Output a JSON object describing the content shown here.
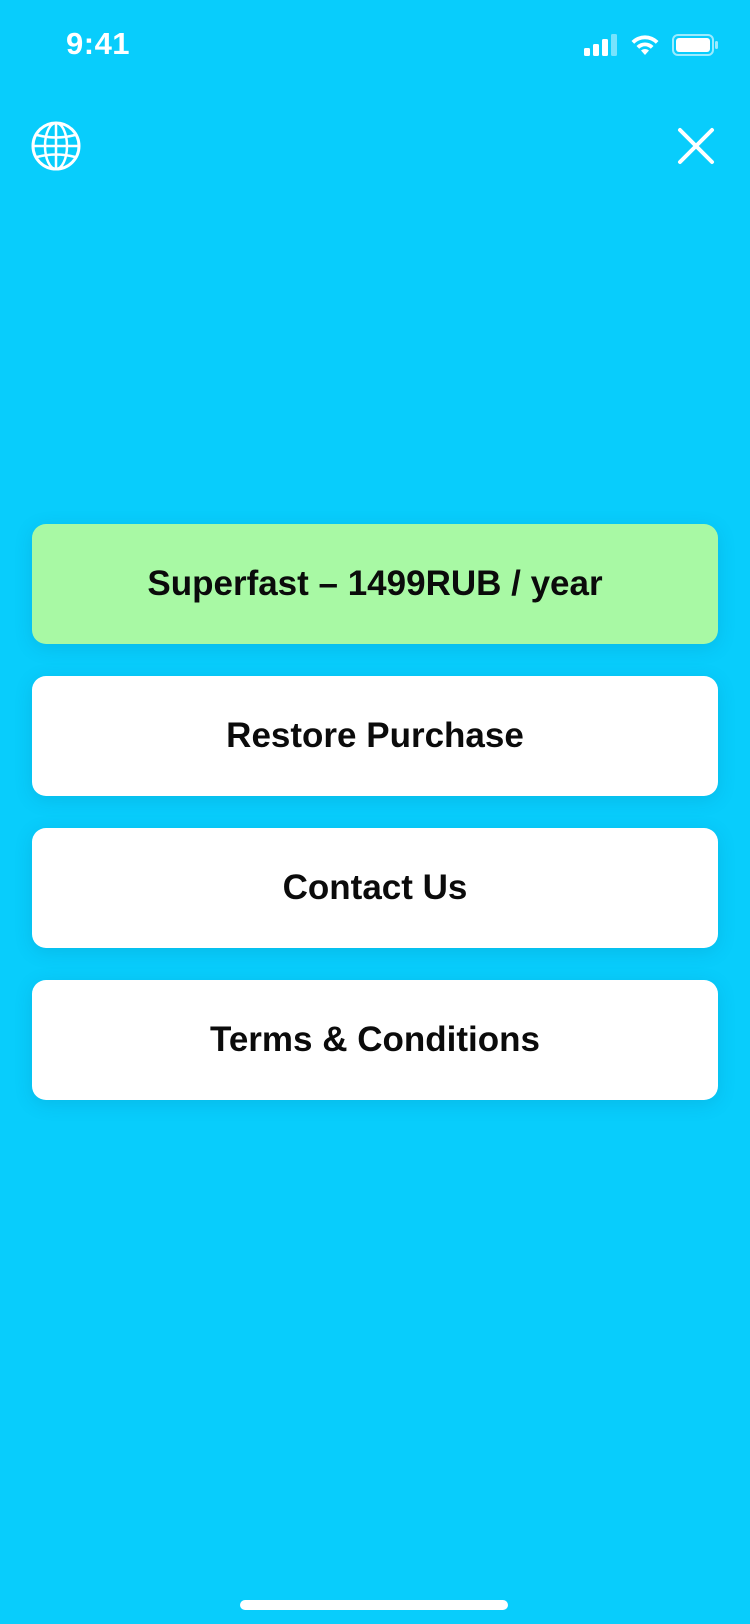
{
  "status_bar": {
    "time": "9:41",
    "icons": [
      "cellular-signal-icon",
      "wifi-icon",
      "battery-icon"
    ]
  },
  "top_controls": {
    "left_icon": "globe-icon",
    "right_icon": "close-icon"
  },
  "menu": {
    "items": [
      {
        "label": "Superfast – 1499RUB / year",
        "style": "primary"
      },
      {
        "label": "Restore Purchase",
        "style": "default"
      },
      {
        "label": "Contact Us",
        "style": "default"
      },
      {
        "label": "Terms & Conditions",
        "style": "default"
      }
    ]
  },
  "colors": {
    "background": "#08CDFC",
    "primary_button": "#A8F9A4",
    "button": "#FFFFFF",
    "text": "#0B0B0B"
  }
}
